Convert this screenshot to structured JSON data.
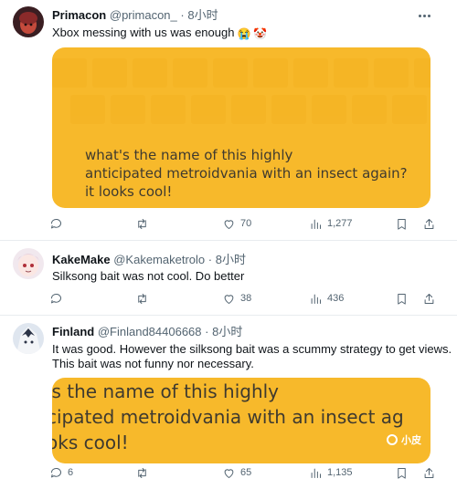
{
  "tweets": [
    {
      "name": "Primacon",
      "handle": "@primacon_",
      "separator": "·",
      "time": "8小时",
      "text": "Xbox messing with us was enough",
      "emojis": [
        "😭",
        "🤡"
      ],
      "media_lines": [
        "what's the name of this highly",
        "anticipated metroidvania with an insect again?",
        "it looks cool!"
      ],
      "actions": {
        "reply": "",
        "retweet": "",
        "like": "70",
        "views": "1,277"
      }
    },
    {
      "name": "KakeMake",
      "handle": "@Kakemaketrolo",
      "separator": "·",
      "time": "8小时",
      "text": "Silksong bait was not cool. Do better",
      "actions": {
        "reply": "",
        "retweet": "",
        "like": "38",
        "views": "436"
      }
    },
    {
      "name": "Finland",
      "handle": "@Finland84406668",
      "separator": "·",
      "time": "8小时",
      "text_lines": [
        "It was good. However the silksong bait was a scummy strategy to get views.",
        "This bait was not funny nor necessary."
      ],
      "media_lines": [
        "'s the name of this highly",
        "cipated metroidvania with an insect ag",
        "oks cool!"
      ],
      "actions": {
        "reply": "6",
        "retweet": "",
        "like": "65",
        "views": "1,135"
      }
    }
  ],
  "watermark": "小皮",
  "colors": {
    "media_bg": "#f7b92b",
    "media_text": "#3f3a2f",
    "muted": "#536471",
    "text": "#0f1419"
  },
  "icons": [
    "reply-icon",
    "retweet-icon",
    "like-icon",
    "views-icon",
    "bookmark-icon",
    "share-icon",
    "more-icon"
  ]
}
